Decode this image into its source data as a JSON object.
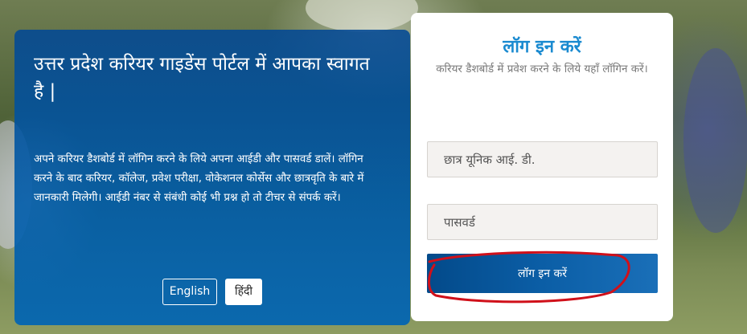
{
  "background": {
    "description_colors": {
      "panel_blue": "#0a5fa8",
      "login_title_blue": "#1a8ad0",
      "button_blue": "#0b5ea6",
      "annotation_red": "#d0101a"
    }
  },
  "welcome": {
    "title": "उत्तर प्रदेश करियर गाइडेंस पोर्टल में आपका स्वागत है |",
    "description": "अपने करियर डैशबोर्ड में लॉगिन करने के लिये अपना आईडी और पासवर्ड डालें। लॉगिन करने के बाद करियर, कॉलेज, प्रवेश परीक्षा, वोकेशनल कोर्सेस और छात्रवृति के बारे में जानकारी मिलेगी। आईडी नंबर से संबंधी कोई भी प्रश्न हो तो टीचर से संपर्क करें।",
    "languages": {
      "english_label": "English",
      "hindi_label": "हिंदी",
      "selected": "हिंदी"
    }
  },
  "login": {
    "title": "लॉग इन करें",
    "subtitle": "करियर डैशबोर्ड में प्रवेश करने के लिये यहाँ लॉगिन करें।",
    "student_id_placeholder": "छात्र यूनिक आई. डी.",
    "password_placeholder": "पासवर्ड",
    "button_label": "लॉग इन करें"
  }
}
